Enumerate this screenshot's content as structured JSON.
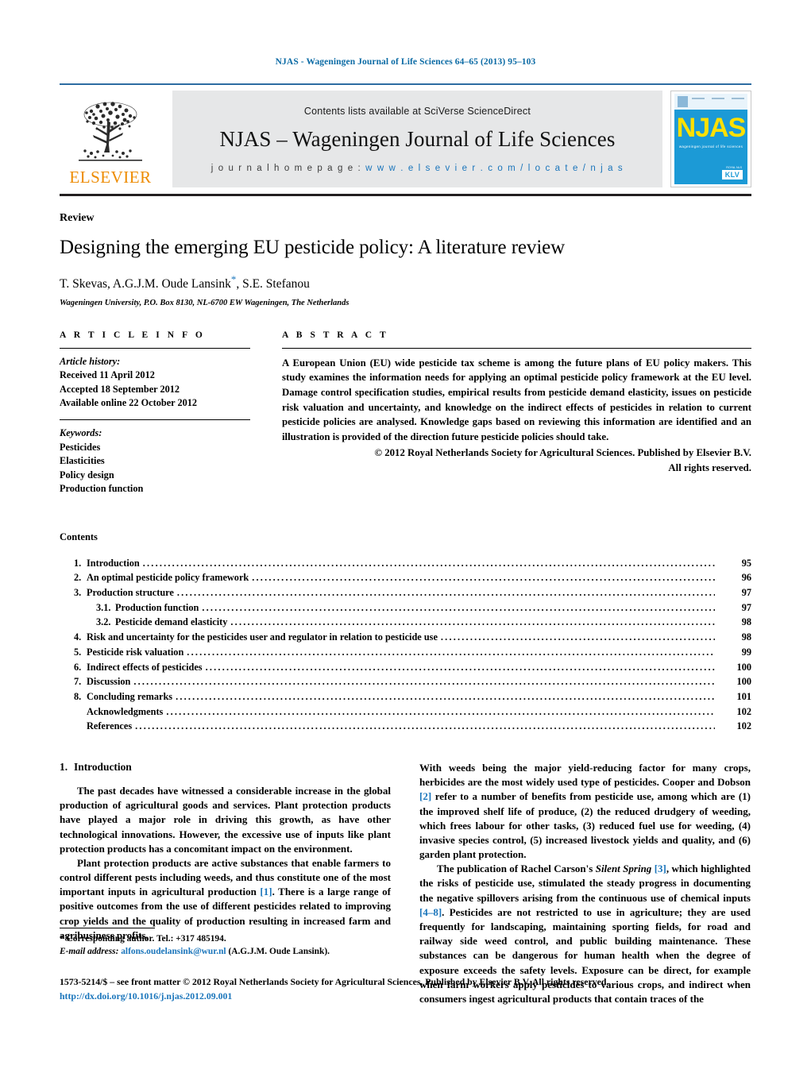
{
  "running_head": "NJAS - Wageningen Journal of Life Sciences 64–65 (2013) 95–103",
  "banner": {
    "publisher_name": "ELSEVIER",
    "contents_line": "Contents lists available at SciVerse ScienceDirect",
    "journal_name": "NJAS – Wageningen Journal of Life Sciences",
    "homepage_label": "j o u r n a l   h o m e p a g e :",
    "homepage_url": "w w w . e l s e v i e r . c o m / l o c a t e / n j a s",
    "cover": {
      "title": "NJAS",
      "subtitle": "wageningen journal of life sciences",
      "badge": "KLV",
      "badge_top": "ROYAL NLS"
    }
  },
  "article": {
    "doctype": "Review",
    "title": "Designing the emerging EU pesticide policy: A literature review",
    "authors": "T. Skevas, A.G.J.M. Oude Lansink",
    "authors_marker": "*",
    "authors_tail": ", S.E. Stefanou",
    "affiliation": "Wageningen University, P.O. Box 8130, NL-6700 EW Wageningen, The Netherlands"
  },
  "article_info": {
    "heading": "A R T I C L E   I N F O",
    "history_label": "Article history:",
    "received": "Received 11 April 2012",
    "accepted": "Accepted 18 September 2012",
    "available": "Available online 22 October 2012",
    "keywords_label": "Keywords:",
    "keywords": [
      "Pesticides",
      "Elasticities",
      "Policy design",
      "Production function"
    ]
  },
  "abstract": {
    "heading": "A B S T R A C T",
    "body": "A European Union (EU) wide pesticide tax scheme is among the future plans of EU policy makers. This study examines the information needs for applying an optimal pesticide policy framework at the EU level. Damage control specification studies, empirical results from pesticide demand elasticity, issues on pesticide risk valuation and uncertainty, and knowledge on the indirect effects of pesticides in relation to current pesticide policies are analysed. Knowledge gaps based on reviewing this information are identified and an illustration is provided of the direction future pesticide policies should take.",
    "copyright": "© 2012 Royal Netherlands Society for Agricultural Sciences. Published by Elsevier B.V.",
    "rights": "All rights reserved."
  },
  "contents": {
    "heading": "Contents",
    "items": [
      {
        "num": "1.",
        "label": "Introduction",
        "page": "95",
        "sub": false
      },
      {
        "num": "2.",
        "label": "An optimal pesticide policy framework",
        "page": "96",
        "sub": false
      },
      {
        "num": "3.",
        "label": "Production structure",
        "page": "97",
        "sub": false
      },
      {
        "num": "3.1.",
        "label": "Production function",
        "page": "97",
        "sub": true
      },
      {
        "num": "3.2.",
        "label": "Pesticide demand elasticity",
        "page": "98",
        "sub": true
      },
      {
        "num": "4.",
        "label": "Risk and uncertainty for the pesticides user and regulator in relation to pesticide use",
        "page": "98",
        "sub": false
      },
      {
        "num": "5.",
        "label": "Pesticide risk valuation",
        "page": "99",
        "sub": false
      },
      {
        "num": "6.",
        "label": "Indirect effects of pesticides",
        "page": "100",
        "sub": false
      },
      {
        "num": "7.",
        "label": "Discussion",
        "page": "100",
        "sub": false
      },
      {
        "num": "8.",
        "label": "Concluding remarks",
        "page": "101",
        "sub": false
      },
      {
        "num": "",
        "label": "Acknowledgments",
        "page": "102",
        "sub": false
      },
      {
        "num": "",
        "label": "References",
        "page": "102",
        "sub": false
      }
    ]
  },
  "section1": {
    "number": "1.",
    "title": "Introduction",
    "para1": "The past decades have witnessed a considerable increase in the global production of agricultural goods and services. Plant protection products have played a major role in driving this growth, as have other technological innovations. However, the excessive use of inputs like plant protection products has a concomitant impact on the environment.",
    "para2a": "Plant protection products are active substances that enable farmers to control different pests including weeds, and thus constitute one of the most important inputs in agricultural production ",
    "para2ref": "[1]",
    "para2b": ". There is a large range of positive outcomes from the use of different pesticides related to improving crop yields and the quality of production resulting in increased farm and agribusiness profits,",
    "para3a": "With weeds being the major yield-reducing factor for many crops, herbicides are the most widely used type of pesticides. Cooper and Dobson ",
    "para3ref": "[2]",
    "para3b": " refer to a number of benefits from pesticide use, among which are (1) the improved shelf life of produce, (2) the reduced drudgery of weeding, which frees labour for other tasks, (3) reduced fuel use for weeding, (4) invasive species control, (5) increased livestock yields and quality, and (6) garden plant protection.",
    "para4a": "The publication of Rachel Carson's ",
    "para4italic": "Silent Spring",
    "para4ref1": "[3]",
    "para4b": ", which highlighted the risks of pesticide use, stimulated the steady progress in documenting the negative spillovers arising from the continuous use of chemical inputs ",
    "para4ref2": "[4–8]",
    "para4c": ". Pesticides are not restricted to use in agriculture; they are used frequently for landscaping, maintaining sporting fields, for road and railway side weed control, and public building maintenance. These substances can be dangerous for human health when the degree of exposure exceeds the safety levels. Exposure can be direct, for example when farm workers apply pesticides to various crops, and indirect when consumers ingest agricultural products that contain traces of the"
  },
  "footnote": {
    "marker": "*",
    "corresponding": " Corresponding author. Tel.: +317 485194.",
    "email_label": "E-mail address:",
    "email": "alfons.oudelansink@wur.nl",
    "email_tail": " (A.G.J.M. Oude Lansink)."
  },
  "footer": {
    "line1": "1573-5214/$ – see front matter © 2012 Royal Netherlands Society for Agricultural Sciences. Published by Elsevier B.V. All rights reserved.",
    "doi": "http://dx.doi.org/10.1016/j.njas.2012.09.001"
  },
  "colors": {
    "link": "#1a75bb",
    "runhead": "#0b6ba5",
    "elsevier_orange": "#ed8b00",
    "cover_blue": "#1c9ad6",
    "cover_yellow": "#ffe000",
    "banner_grey": "#e6e7e8"
  }
}
